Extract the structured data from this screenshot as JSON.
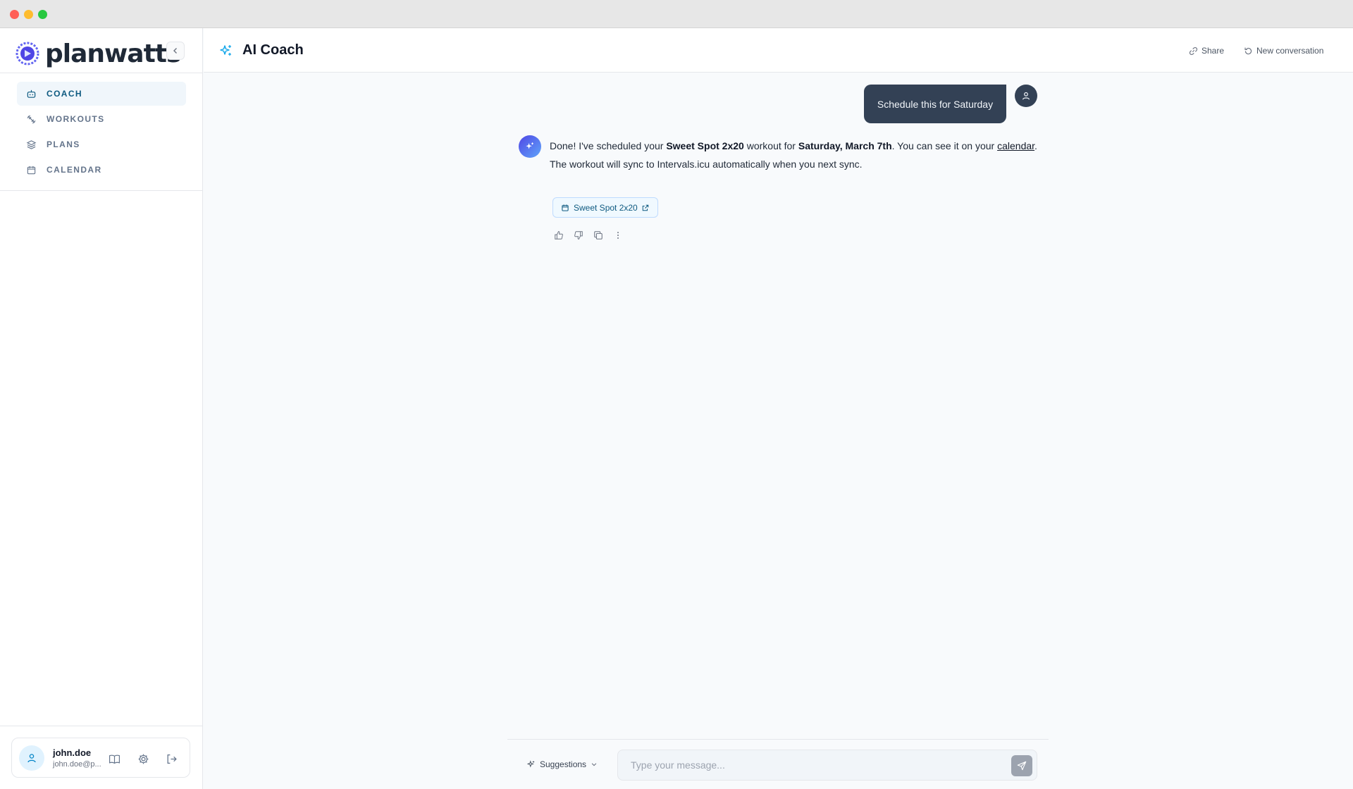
{
  "brand": {
    "name": "planwatts"
  },
  "sidebar": {
    "items": [
      {
        "label": "COACH",
        "icon": "robot-icon",
        "active": true
      },
      {
        "label": "WORKOUTS",
        "icon": "dumbbell-icon",
        "active": false
      },
      {
        "label": "PLANS",
        "icon": "layers-icon",
        "active": false
      },
      {
        "label": "CALENDAR",
        "icon": "calendar-icon",
        "active": false
      }
    ]
  },
  "user": {
    "name": "john.doe",
    "email": "john.doe@p..."
  },
  "header": {
    "title": "AI Coach",
    "share_label": "Share",
    "new_conversation_label": "New conversation"
  },
  "chat": {
    "user_message": "Schedule this for Saturday",
    "ai_message": {
      "p1_a": "Done! I've scheduled your ",
      "p1_workout": "Sweet Spot 2x20",
      "p1_b": " workout for ",
      "p1_date": "Saturday, March 7th",
      "p1_c": ". You can see it on your ",
      "p1_link": "calendar",
      "p1_d": ".",
      "p2": "The workout will sync to Intervals.icu automatically when you next sync."
    },
    "chip_label": "Sweet Spot 2x20"
  },
  "composer": {
    "suggestions_label": "Suggestions",
    "placeholder": "Type your message..."
  },
  "colors": {
    "accent": "#0e5a80",
    "user_bubble": "#334155",
    "send_disabled": "#9ca3af"
  }
}
